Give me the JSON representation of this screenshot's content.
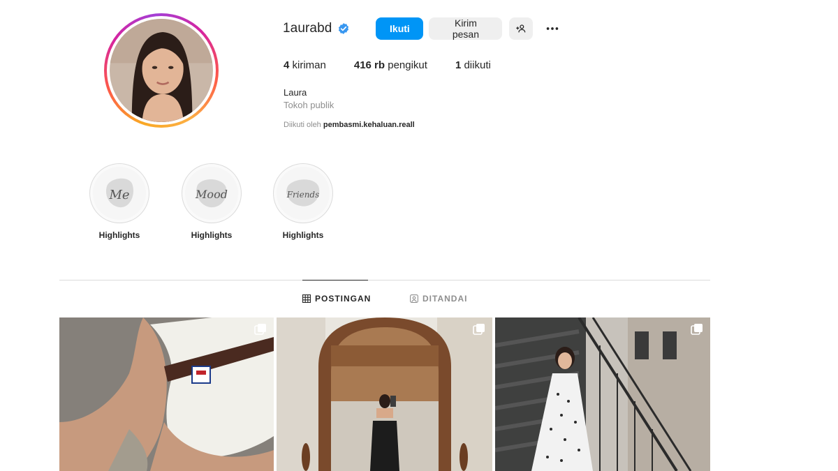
{
  "profile": {
    "username": "1aurabd",
    "verified": true,
    "follow_label": "Ikuti",
    "message_label": "Kirim pesan",
    "full_name": "Laura",
    "category": "Tokoh publik",
    "followed_by_prefix": "Diikuti oleh",
    "followed_by_user": "pembasmi.kehaluan.reall"
  },
  "stats": {
    "posts_count": "4",
    "posts_label": "kiriman",
    "followers_count": "416 rb",
    "followers_label": "pengikut",
    "following_count": "1",
    "following_label": "diikuti"
  },
  "highlights": [
    {
      "label": "Highlights",
      "cover_text": "Me"
    },
    {
      "label": "Highlights",
      "cover_text": "Mood"
    },
    {
      "label": "Highlights",
      "cover_text": "Friends"
    }
  ],
  "tabs": [
    {
      "label": "POSTINGAN",
      "icon": "grid-icon",
      "active": true
    },
    {
      "label": "DITANDAI",
      "icon": "tagged-icon",
      "active": false
    }
  ],
  "colors": {
    "accent": "#0095f6",
    "verified": "#3897f0",
    "secondary_text": "#8e8e8e",
    "button_gray": "#efefef"
  }
}
